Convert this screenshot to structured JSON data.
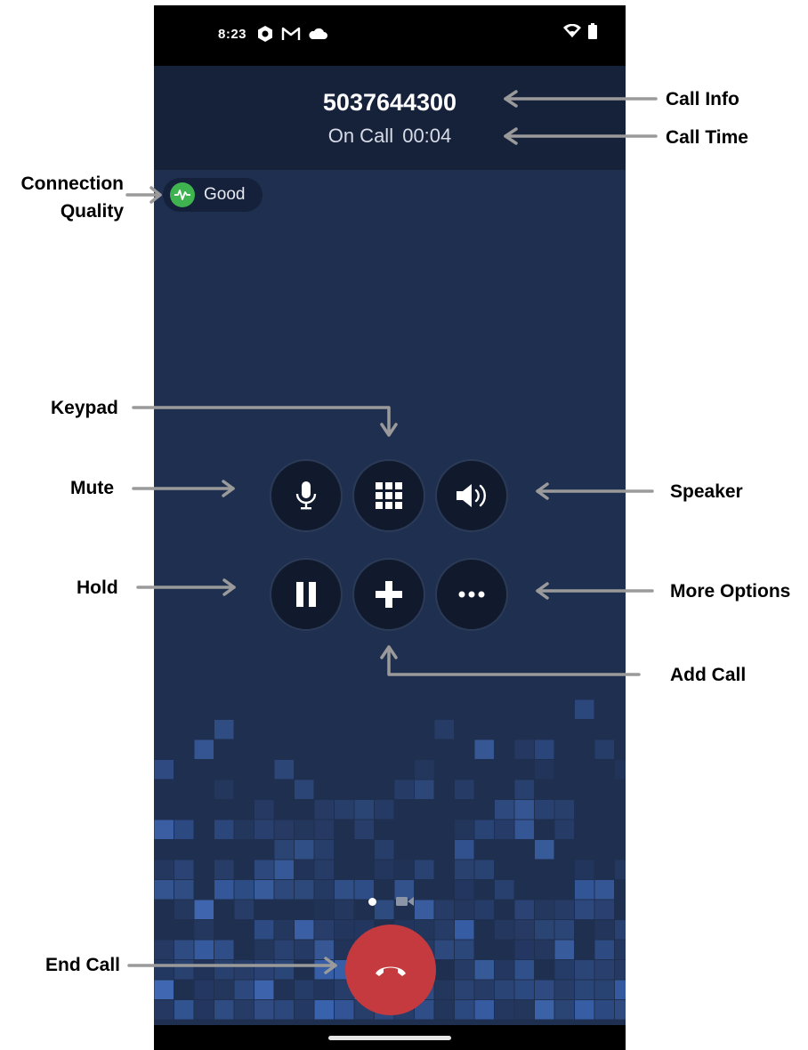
{
  "status_bar": {
    "time": "8:23",
    "left_icons": [
      "settings-app-icon",
      "gmail-icon",
      "cloud-icon"
    ],
    "right_icons": [
      "wifi-icon",
      "battery-icon"
    ]
  },
  "call": {
    "number": "5037644300",
    "status": "On Call",
    "duration": "00:04"
  },
  "connection": {
    "quality_label": "Good",
    "quality_color": "#3fb34f"
  },
  "controls": {
    "row1": [
      {
        "name": "mute-button",
        "icon": "microphone-icon"
      },
      {
        "name": "keypad-button",
        "icon": "keypad-icon"
      },
      {
        "name": "speaker-button",
        "icon": "speaker-icon"
      }
    ],
    "row2": [
      {
        "name": "hold-button",
        "icon": "pause-icon"
      },
      {
        "name": "add-call-button",
        "icon": "plus-icon"
      },
      {
        "name": "more-options-button",
        "icon": "ellipsis-icon"
      }
    ]
  },
  "end_call": {
    "icon": "phone-hangup-icon",
    "color": "#c43a3e"
  },
  "annotations": {
    "call_info": "Call Info",
    "call_time": "Call Time",
    "connection_line1": "Connection",
    "connection_line2": "Quality",
    "keypad": "Keypad",
    "mute": "Mute",
    "speaker": "Speaker",
    "hold": "Hold",
    "more_options": "More Options",
    "add_call": "Add Call",
    "end_call": "End Call"
  },
  "theme": {
    "background": "#1f2f4f",
    "header": "#16213a",
    "button": "#111a2c",
    "mosaic_blue": "#3a64b0"
  }
}
